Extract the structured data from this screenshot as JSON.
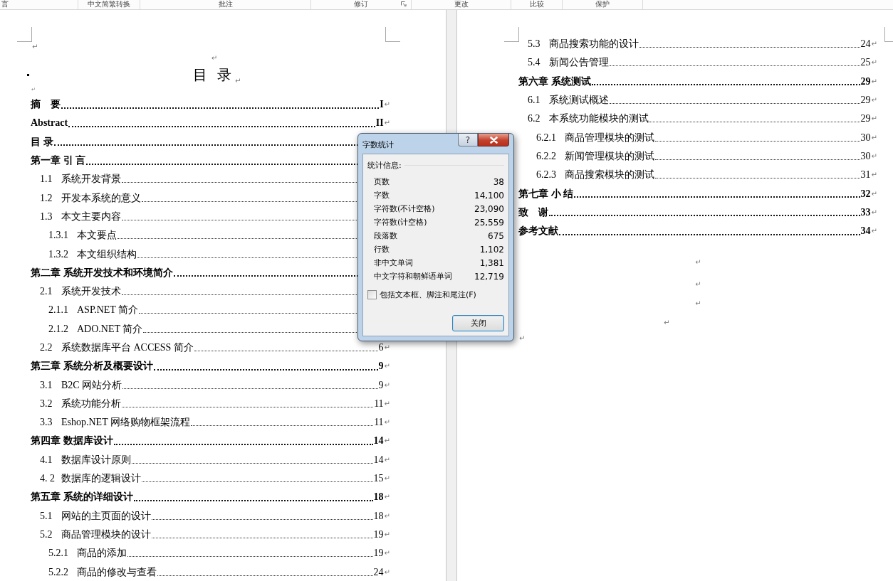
{
  "ribbon": {
    "groups": [
      {
        "label": "言"
      },
      {
        "label": "中文简繁转换"
      },
      {
        "label": "批注"
      },
      {
        "label": "修订",
        "launcher": true
      },
      {
        "label": "更改"
      },
      {
        "label": "比较"
      },
      {
        "label": "保护"
      }
    ]
  },
  "left_page": {
    "top_marks": [
      "↵",
      "↵"
    ],
    "title": "目 录",
    "title_mark": "↵",
    "small_mark": "↵",
    "entries": [
      {
        "kind": "chapter",
        "title": "摘　要",
        "page": "I",
        "mark": "↵"
      },
      {
        "kind": "chapter",
        "title": "Abstract",
        "page": "II",
        "mark": "↵"
      },
      {
        "kind": "chapter",
        "title": "目 录"
      },
      {
        "kind": "chapter",
        "title": "第一章 引 言",
        "children": [
          {
            "kind": "section",
            "number": "1.1",
            "title": "系统开发背景"
          },
          {
            "kind": "section",
            "number": "1.2",
            "title": "开发本系统的意义"
          },
          {
            "kind": "section",
            "number": "1.3",
            "title": "本文主要内容",
            "children": [
              {
                "kind": "subsection",
                "number": "1.3.1",
                "title": "本文要点"
              },
              {
                "kind": "subsection",
                "number": "1.3.2",
                "title": "本文组织结构"
              }
            ]
          }
        ]
      },
      {
        "kind": "chapter",
        "title": "第二章 系统开发技术和环境简介",
        "children": [
          {
            "kind": "section",
            "number": "2.1",
            "title": "系统开发技术",
            "children": [
              {
                "kind": "subsection",
                "number": "2.1.1",
                "title": "ASP.NET 简介"
              },
              {
                "kind": "subsection",
                "number": "2.1.2",
                "title": "ADO.NET 简介"
              }
            ]
          },
          {
            "kind": "section",
            "number": "2.2",
            "title": "系统数据库平台 ACCESS 简介",
            "page": "6",
            "mark": "↵"
          }
        ]
      },
      {
        "kind": "chapter",
        "title": "第三章 系统分析及概要设计",
        "page": "9",
        "mark": "↵",
        "children": [
          {
            "kind": "section",
            "number": "3.1",
            "title": "B2C 网站分析",
            "page": "9",
            "mark": "↵"
          },
          {
            "kind": "section",
            "number": "3.2",
            "title": "系统功能分析",
            "page": "11",
            "mark": "↵"
          },
          {
            "kind": "section",
            "number": "3.3",
            "title": "Eshop.NET 网络购物框架流程",
            "page": "11",
            "mark": "↵"
          }
        ]
      },
      {
        "kind": "chapter",
        "title": "第四章 数据库设计",
        "page": "14",
        "mark": "↵",
        "children": [
          {
            "kind": "section",
            "number": "4.1",
            "title": "数据库设计原则",
            "page": "14",
            "mark": "↵"
          },
          {
            "kind": "section",
            "number": "4. 2",
            "title": "数据库的逻辑设计",
            "page": "15",
            "mark": "↵"
          }
        ]
      },
      {
        "kind": "chapter",
        "title": "第五章 系统的详细设计",
        "page": "18",
        "mark": "↵",
        "children": [
          {
            "kind": "section",
            "number": "5.1",
            "title": "网站的主页面的设计",
            "page": "18",
            "mark": "↵"
          },
          {
            "kind": "section",
            "number": "5.2",
            "title": "商品管理模块的设计",
            "page": "19",
            "mark": "↵",
            "children": [
              {
                "kind": "subsection",
                "number": "5.2.1",
                "title": "商品的添加",
                "page": "19",
                "mark": "↵"
              },
              {
                "kind": "subsection",
                "number": "5.2.2",
                "title": "商品的修改与查看",
                "page": "24",
                "mark": "↵"
              }
            ]
          }
        ]
      }
    ]
  },
  "right_page": {
    "entries": [
      {
        "kind": "section",
        "number": "5.3",
        "title": "商品搜索功能的设计",
        "page": "24",
        "mark": "↵"
      },
      {
        "kind": "section",
        "number": "5.4",
        "title": "新闻公告管理",
        "page": "25",
        "mark": "↵"
      },
      {
        "kind": "chapter",
        "title": "第六章 系统测试",
        "page": "29",
        "mark": "↵",
        "children": [
          {
            "kind": "section",
            "number": "6.1",
            "title": "系统测试概述",
            "page": "29",
            "mark": "↵"
          },
          {
            "kind": "section",
            "number": "6.2",
            "title": "本系统功能模块的测试",
            "page": "29",
            "mark": "↵",
            "children": [
              {
                "kind": "subsection",
                "number": "6.2.1",
                "title": "商品管理模块的测试",
                "page": "30",
                "mark": "↵"
              },
              {
                "kind": "subsection",
                "number": "6.2.2",
                "title": "新闻管理模块的测试",
                "page": "30",
                "mark": "↵"
              },
              {
                "kind": "subsection",
                "number": "6.2.3",
                "title": "商品搜索模块的测试",
                "page": "31",
                "mark": "↵"
              }
            ]
          }
        ]
      },
      {
        "kind": "chapter",
        "title": "第七章 小 结",
        "page": "32",
        "mark": "↵"
      },
      {
        "kind": "chapter",
        "title": "致　谢",
        "page": "33",
        "mark": "↵"
      },
      {
        "kind": "chapter",
        "title": "参考文献",
        "page": "34",
        "mark": "↵"
      }
    ],
    "trailing_marks": [
      {
        "kind": "center",
        "text": "↵"
      },
      {
        "kind": "center",
        "text": "↵"
      },
      {
        "kind": "center",
        "text": "↵"
      },
      {
        "kind": "offset",
        "text": "↵"
      },
      {
        "kind": "left",
        "text": "↵"
      }
    ]
  },
  "dialog": {
    "title": "字数统计",
    "help": "?",
    "group_label": "统计信息:",
    "stats": [
      {
        "label": "页数",
        "value": "38"
      },
      {
        "label": "字数",
        "value": "14,100"
      },
      {
        "label": "字符数(不计空格)",
        "value": "23,090"
      },
      {
        "label": "字符数(计空格)",
        "value": "25,559"
      },
      {
        "label": "段落数",
        "value": "675"
      },
      {
        "label": "行数",
        "value": "1,102"
      },
      {
        "label": "非中文单词",
        "value": "1,381"
      },
      {
        "label": "中文字符和朝鲜语单词",
        "value": "12,719"
      }
    ],
    "checkbox": {
      "label": "包括文本框、脚注和尾注(F)",
      "checked": false
    },
    "button": "关闭"
  }
}
